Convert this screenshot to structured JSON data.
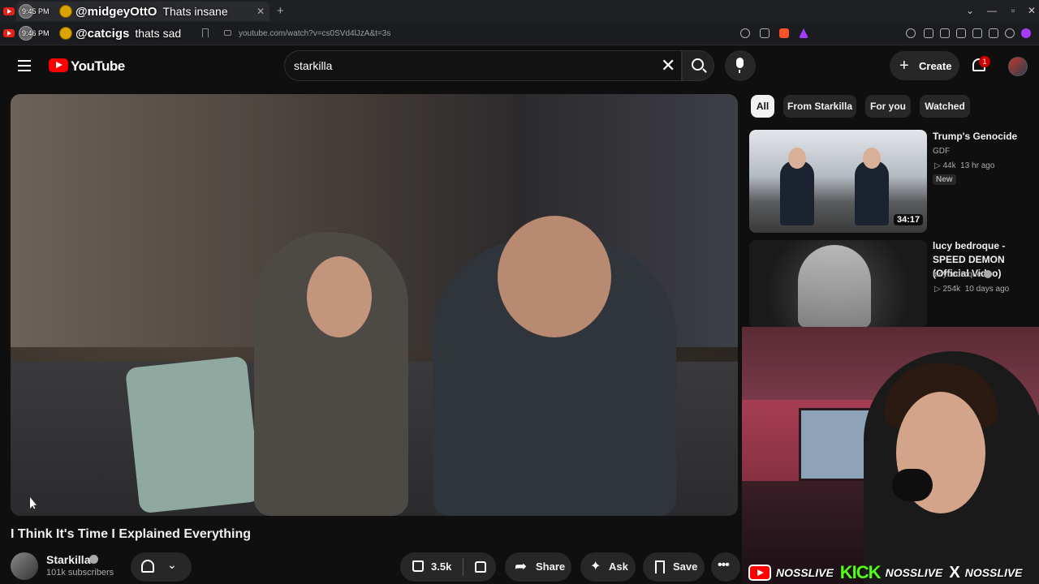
{
  "chat_overlay": [
    {
      "time": "9:45 PM",
      "user": "@midgeyOttO",
      "message": "Thats insane"
    },
    {
      "time": "9:46 PM",
      "user": "@catcigs",
      "message": "thats sad"
    }
  ],
  "browser": {
    "url": "youtube.com/watch?v=cs0SVd4lJzA&t=3s"
  },
  "header": {
    "logo_text": "YouTube",
    "search_value": "starkilla",
    "create_label": "Create",
    "notification_count": "1"
  },
  "video": {
    "title": "I Think It's Time I Explained Everything",
    "channel": "Starkilla",
    "subscribers": "101k subscribers",
    "likes": "3.5k",
    "share_label": "Share",
    "ask_label": "Ask",
    "save_label": "Save"
  },
  "chips": [
    "All",
    "From Starkilla",
    "For you",
    "Watched"
  ],
  "recommendations": [
    {
      "title": "Trump's Genocide",
      "channel": "GDF",
      "views": "44k",
      "age": "13 hr ago",
      "badge": "New",
      "duration": "34:17"
    },
    {
      "title": "lucy bedroque - SPEED DEMON (Official Video)",
      "channel": "lucybedroque",
      "views": "254k",
      "age": "10 days ago"
    }
  ],
  "social_strip": {
    "handle": "NOSSLIVE",
    "kick_label": "KICK",
    "x_label": "X"
  },
  "colors": {
    "background": "#0f0f0f",
    "youtube_red": "#ff0000",
    "kick_green": "#53fc18"
  }
}
